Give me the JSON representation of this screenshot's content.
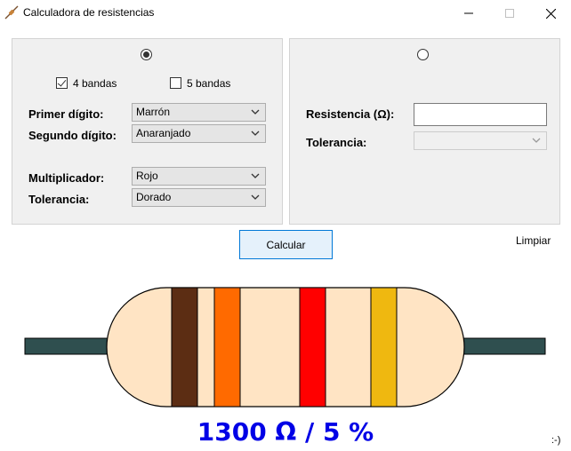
{
  "window": {
    "title": "Calculadora de resistencias",
    "min_symbol": "–",
    "max_symbol": "□",
    "close_symbol": "✕"
  },
  "bands_panel": {
    "selected": true,
    "four_bands": {
      "label": "4 bandas",
      "checked": true
    },
    "five_bands": {
      "label": "5 bandas",
      "checked": false
    },
    "first_digit": {
      "label": "Primer dígito:",
      "value": "Marrón"
    },
    "second_digit": {
      "label": "Segundo dígito:",
      "value": "Anaranjado"
    },
    "multiplier": {
      "label": "Multiplicador:",
      "value": "Rojo"
    },
    "tolerance": {
      "label": "Tolerancia:",
      "value": "Dorado"
    }
  },
  "value_panel": {
    "selected": false,
    "resistance": {
      "label": "Resistencia (Ω):",
      "value": ""
    },
    "tolerance": {
      "label": "Tolerancia:",
      "value": ""
    }
  },
  "actions": {
    "calculate_label": "Calcular",
    "clear_label": "Limpiar"
  },
  "resistor": {
    "lead_color": "#2f4f4f",
    "body_color": "#ffe4c4",
    "bands": [
      {
        "color": "#5c2d13"
      },
      {
        "color": "#ff6a00"
      },
      {
        "color": "#ff0000"
      },
      {
        "color": "#efb810"
      }
    ]
  },
  "result": {
    "text": "1300 Ω / 5 %"
  },
  "footer": {
    "smiley": ":-)"
  },
  "icons": {
    "app": "resistor-icon",
    "dropdown": "chevron-down-icon"
  }
}
